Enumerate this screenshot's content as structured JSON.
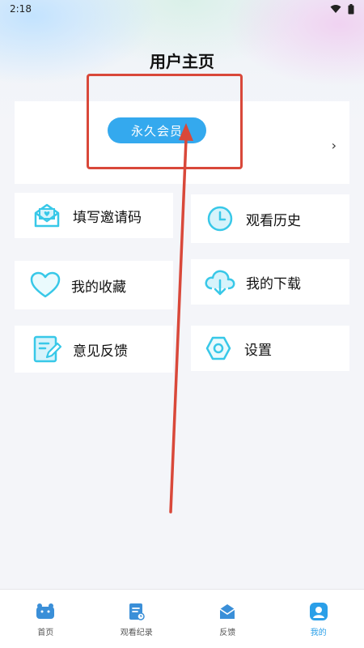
{
  "status_bar": {
    "time": "2:18"
  },
  "header": {
    "title": "用户主页"
  },
  "vip": {
    "button_label": "永久会员",
    "chevron": "›"
  },
  "menu": {
    "invite_code": "填写邀请码",
    "history": "观看历史",
    "favorites": "我的收藏",
    "downloads": "我的下载",
    "feedback": "意见反馈",
    "settings": "设置"
  },
  "tabs": [
    {
      "label": "首页",
      "icon": "home-icon"
    },
    {
      "label": "观看纪录",
      "icon": "record-icon"
    },
    {
      "label": "反馈",
      "icon": "mail-icon"
    },
    {
      "label": "我的",
      "icon": "profile-icon",
      "active": true
    }
  ],
  "colors": {
    "accent": "#34a9ee",
    "icon_cyan": "#38c8e8",
    "annotation_red": "#d9483a"
  }
}
